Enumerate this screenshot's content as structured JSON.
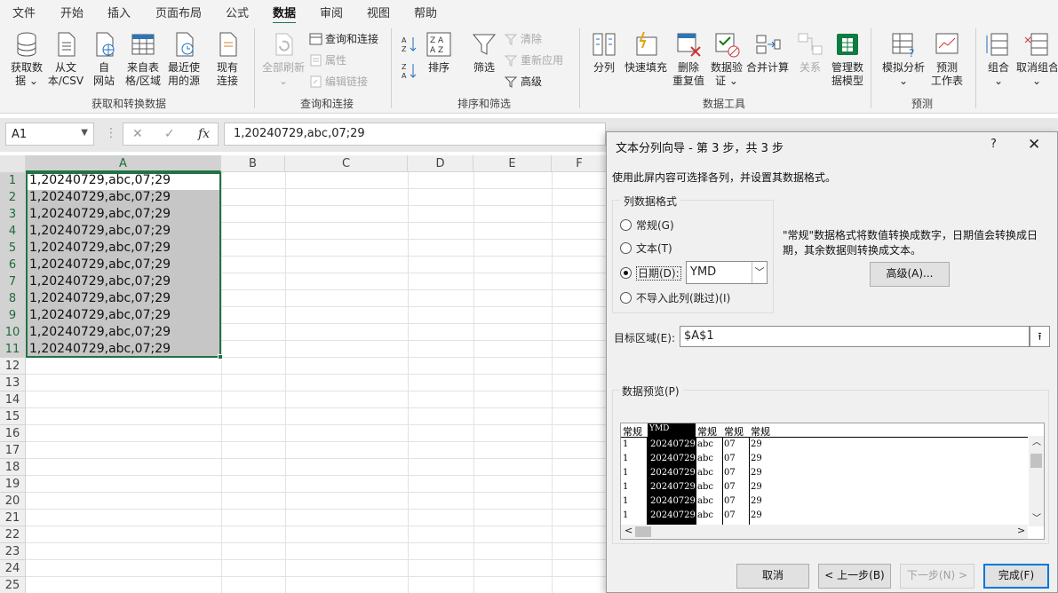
{
  "menu": {
    "tabs": [
      "文件",
      "开始",
      "插入",
      "页面布局",
      "公式",
      "数据",
      "审阅",
      "视图",
      "帮助"
    ],
    "active": "数据"
  },
  "ribbon": {
    "get_data": {
      "label1": "获取数",
      "label2": "据 ⌄"
    },
    "from_csv": {
      "label1": "从文",
      "label2": "本/CSV"
    },
    "from_web": {
      "label1": "自",
      "label2": "网站"
    },
    "from_table": {
      "label1": "来自表",
      "label2": "格/区域"
    },
    "recent": {
      "label1": "最近使",
      "label2": "用的源"
    },
    "existing": {
      "label1": "现有",
      "label2": "连接"
    },
    "group1": "获取和转换数据",
    "refresh_all": {
      "label1": "全部刷新",
      "label2": "⌄"
    },
    "queries": "查询和连接",
    "properties": "属性",
    "edit_links": "编辑链接",
    "group2": "查询和连接",
    "sort": "排序",
    "filter": "筛选",
    "clear": "清除",
    "reapply": "重新应用",
    "advanced": "高级",
    "group3": "排序和筛选",
    "text_to_col": "分列",
    "flash_fill": "快速填充",
    "remove_dup": {
      "label1": "删除",
      "label2": "重复值"
    },
    "validation": {
      "label1": "数据验",
      "label2": "证 ⌄"
    },
    "consolidate": "合并计算",
    "relations": "关系",
    "manage_model": {
      "label1": "管理数",
      "label2": "据模型"
    },
    "group4": "数据工具",
    "whatif": {
      "label1": "模拟分析",
      "label2": "⌄"
    },
    "forecast": {
      "label1": "预测",
      "label2": "工作表"
    },
    "group5": "预测",
    "group": {
      "label1": "组合",
      "label2": "⌄"
    },
    "ungroup": {
      "label1": "取消组合",
      "label2": "⌄"
    }
  },
  "formula_bar": {
    "name_box": "A1",
    "fx": "fx",
    "formula": "1,20240729,abc,07;29"
  },
  "sheet": {
    "columns": [
      "A",
      "B",
      "C",
      "D",
      "E",
      "F"
    ],
    "rows": [
      "1",
      "2",
      "3",
      "4",
      "5",
      "6",
      "7",
      "8",
      "9",
      "10",
      "11",
      "12",
      "13",
      "14",
      "15",
      "16",
      "17",
      "18",
      "19",
      "20",
      "21",
      "22",
      "23",
      "24",
      "25"
    ],
    "cells": [
      "1,20240729,abc,07;29",
      "1,20240729,abc,07;29",
      "1,20240729,abc,07;29",
      "1,20240729,abc,07;29",
      "1,20240729,abc,07;29",
      "1,20240729,abc,07;29",
      "1,20240729,abc,07;29",
      "1,20240729,abc,07;29",
      "1,20240729,abc,07;29",
      "1,20240729,abc,07;29",
      "1,20240729,abc,07;29"
    ]
  },
  "dialog": {
    "title": "文本分列向导 - 第 3 步，共 3 步",
    "help": "?",
    "close": "✕",
    "instruction": "使用此屏内容可选择各列，并设置其数据格式。",
    "format_group": "列数据格式",
    "opt_general": "常规(G)",
    "opt_text": "文本(T)",
    "opt_date": "日期(D):",
    "date_format": "YMD",
    "opt_skip": "不导入此列(跳过)(I)",
    "description": "\"常规\"数据格式将数值转换成数字，日期值会转换成日期，其余数据则转换成文本。",
    "advanced_btn": "高级(A)...",
    "dest_label": "目标区域(E):",
    "dest_value": "$A$1",
    "preview_label": "数据预览(P)",
    "preview_headers": [
      "常规",
      "YMD",
      "常规",
      "常规",
      "常规"
    ],
    "preview_rows": [
      [
        "1",
        "20240729",
        "abc",
        "07",
        "29"
      ],
      [
        "1",
        "20240729",
        "abc",
        "07",
        "29"
      ],
      [
        "1",
        "20240729",
        "abc",
        "07",
        "29"
      ],
      [
        "1",
        "20240729",
        "abc",
        "07",
        "29"
      ],
      [
        "1",
        "20240729",
        "abc",
        "07",
        "29"
      ],
      [
        "1",
        "20240729",
        "abc",
        "07",
        "29"
      ]
    ],
    "btn_cancel": "取消",
    "btn_back": "< 上一步(B)",
    "btn_next": "下一步(N) >",
    "btn_finish": "完成(F)"
  },
  "colors": {
    "accent": "#217346",
    "selection": "#c6c6c6",
    "dialog_bg": "#f0f0f0",
    "focus": "#0078d7"
  }
}
